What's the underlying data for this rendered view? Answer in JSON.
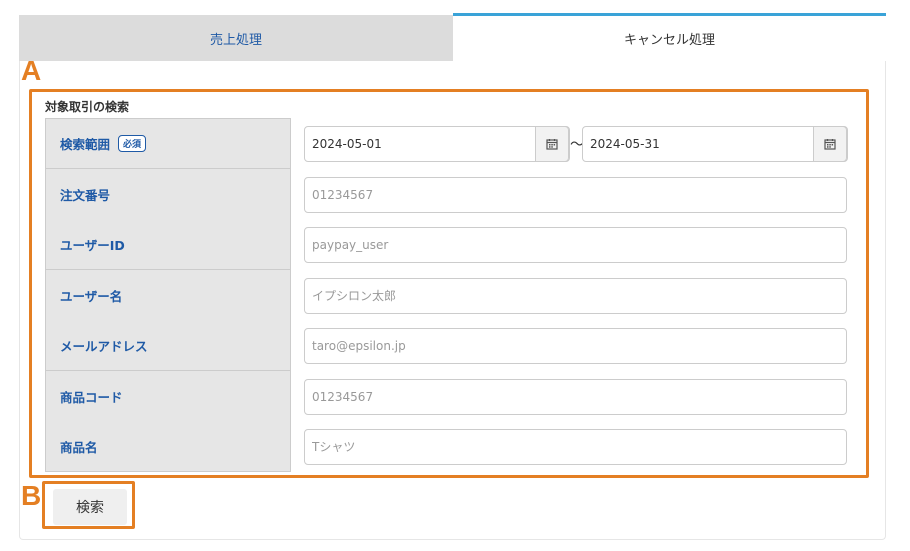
{
  "tabs": {
    "sales_label": "売上処理",
    "cancel_label": "キャンセル処理"
  },
  "markers": {
    "a": "A",
    "b": "B"
  },
  "section": {
    "title": "対象取引の検索",
    "required_badge": "必須",
    "tilde": "～",
    "fields": [
      {
        "label": "検索範囲",
        "from_value": "2024-05-01",
        "to_value": "2024-05-31"
      },
      {
        "label": "注文番号",
        "placeholder": "01234567"
      },
      {
        "label": "ユーザーID",
        "placeholder": "paypay_user"
      },
      {
        "label": "ユーザー名",
        "placeholder": "イプシロン太郎"
      },
      {
        "label": "メールアドレス",
        "placeholder": "taro@epsilon.jp"
      },
      {
        "label": "商品コード",
        "placeholder": "01234567"
      },
      {
        "label": "商品名",
        "placeholder": "Tシャツ"
      }
    ]
  },
  "search_button": {
    "label": "検索"
  },
  "colors": {
    "accent": "#3aa3d8",
    "highlight": "#e47f23",
    "label_text": "#1f5aa6"
  },
  "icons": {
    "calendar": "calendar-icon"
  }
}
